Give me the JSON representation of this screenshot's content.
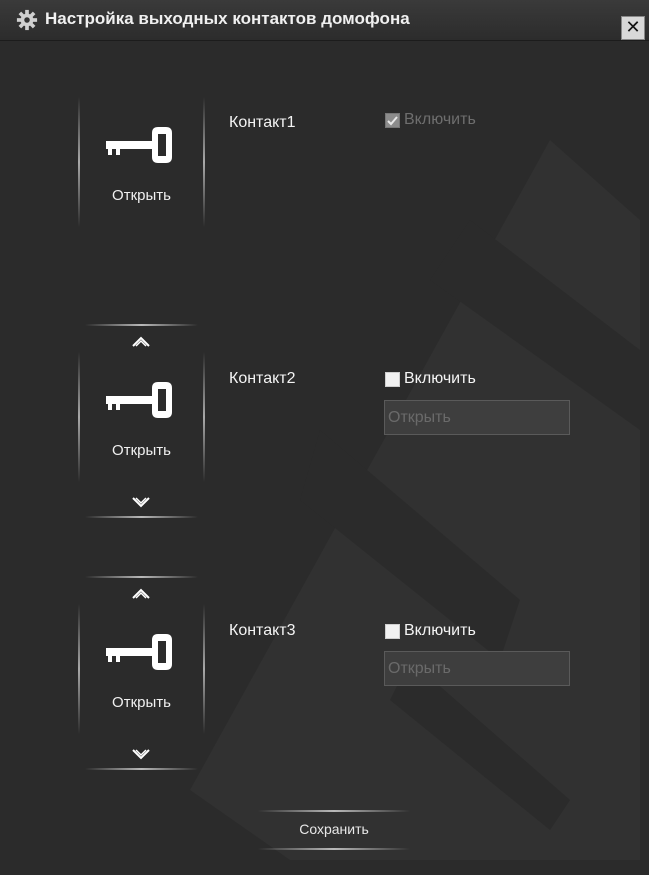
{
  "window": {
    "title": "Настройка выходных контактов домофона",
    "close_glyph": "✕"
  },
  "contacts": [
    {
      "name": "Контакт1",
      "key_label": "Открыть",
      "enable_label": "Включить",
      "enabled": true,
      "enable_disabled": true,
      "field_value": null
    },
    {
      "name": "Контакт2",
      "key_label": "Открыть",
      "enable_label": "Включить",
      "enabled": false,
      "enable_disabled": false,
      "field_value": "Открыть"
    },
    {
      "name": "Контакт3",
      "key_label": "Открыть",
      "enable_label": "Включить",
      "enabled": false,
      "enable_disabled": false,
      "field_value": "Открыть"
    }
  ],
  "footer": {
    "save_label": "Сохранить"
  },
  "icons": {
    "title": "gear-icon",
    "close": "close-icon",
    "key": "key-icon",
    "move_up": "chevron-up-icon",
    "move_down": "chevron-down-icon"
  },
  "colors": {
    "background": "#2b2b2b",
    "text": "#ffffff",
    "disabled_text": "#6e6e6e",
    "field_background": "#3e3e3e"
  }
}
